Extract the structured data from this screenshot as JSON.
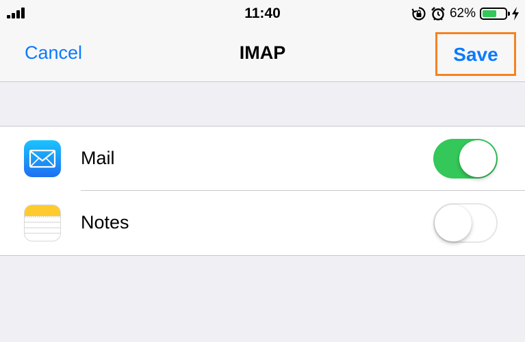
{
  "status_bar": {
    "time": "11:40",
    "battery_percent": "62%",
    "battery_level": 0.62,
    "icons": [
      "signal-icon",
      "rotation-lock-icon",
      "alarm-icon",
      "battery-icon",
      "charging-bolt-icon"
    ]
  },
  "nav": {
    "cancel_label": "Cancel",
    "title": "IMAP",
    "save_label": "Save",
    "highlight_color": "#f58220"
  },
  "items": [
    {
      "label": "Mail",
      "icon": "mail-icon",
      "enabled": true
    },
    {
      "label": "Notes",
      "icon": "notes-icon",
      "enabled": false
    }
  ],
  "colors": {
    "accent": "#0a7aff",
    "toggle_on": "#34c759",
    "background": "#efeff4"
  }
}
